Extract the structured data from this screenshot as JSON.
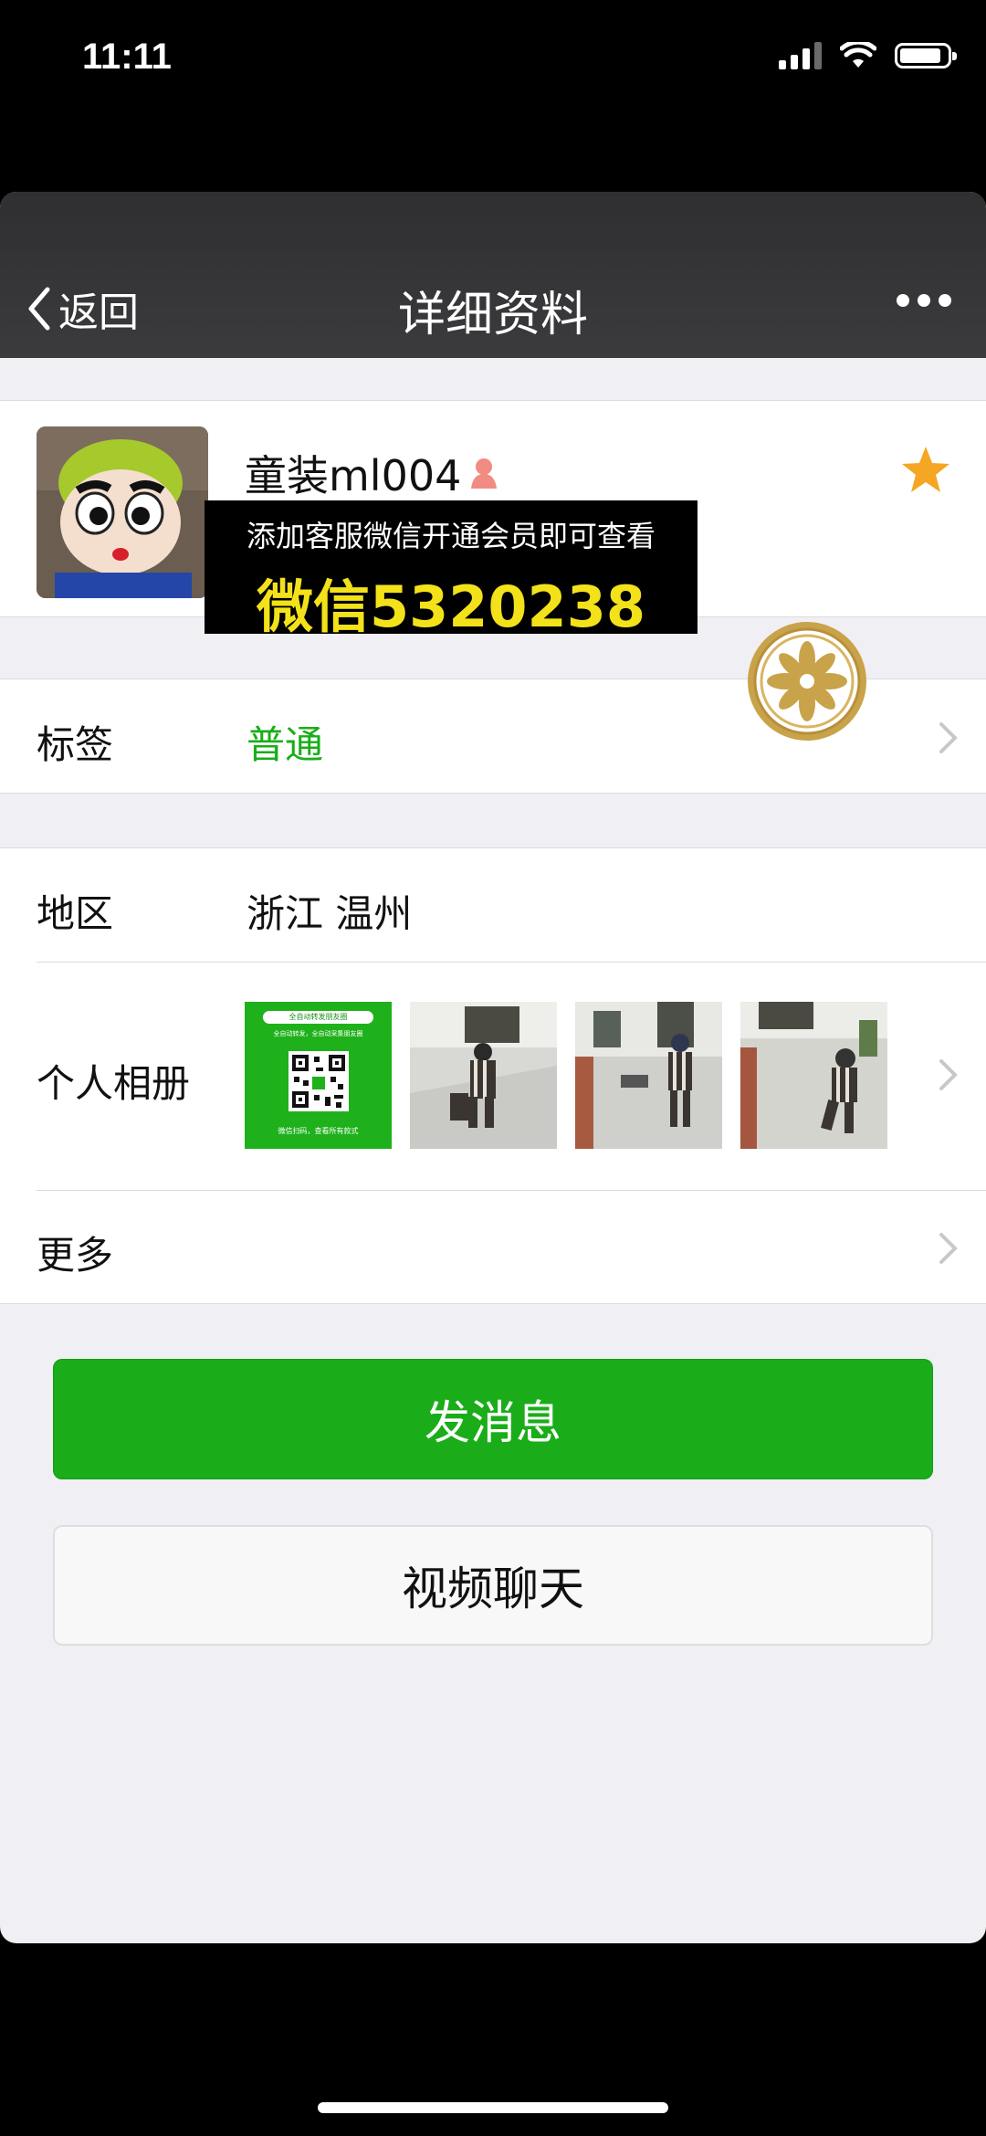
{
  "status_bar": {
    "time": "11:11"
  },
  "nav": {
    "back_label": "返回",
    "title": "详细资料"
  },
  "profile": {
    "name": "童装ml004"
  },
  "promo": {
    "line1": "添加客服微信开通会员即可查看",
    "line2": "微信5320238"
  },
  "rows": {
    "tag": {
      "label": "标签",
      "value": "普通"
    },
    "region": {
      "label": "地区",
      "value": "浙江 温州"
    },
    "album": {
      "label": "个人相册"
    },
    "more": {
      "label": "更多"
    }
  },
  "album_qr": {
    "title": "全自动转发朋友圈",
    "subtitle": "全自动转发，全自动采集朋友圈",
    "footer": "微信扫码，查看所有款式"
  },
  "buttons": {
    "message": "发消息",
    "video_call": "视频聊天"
  },
  "colors": {
    "accent_green": "#1aad19",
    "nav_bg": "#333335",
    "star": "#f5a623",
    "promo_text": "#f3e21a"
  }
}
